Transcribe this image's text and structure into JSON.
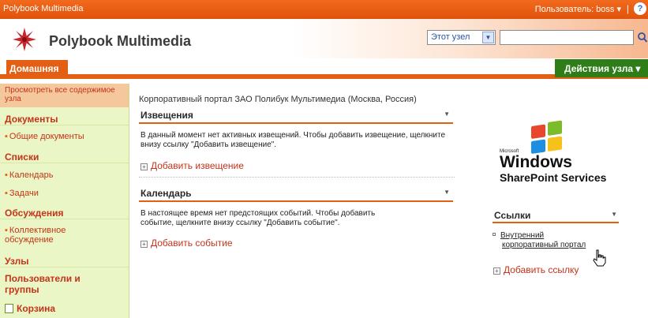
{
  "topbar": {
    "site_name": "Polybook Multimedia",
    "user_label": "Пользователь: boss ▾",
    "separator": "|",
    "help_icon": "?"
  },
  "header": {
    "title": "Polybook Multimedia",
    "scope_value": "Этот узел",
    "search_value": ""
  },
  "tabs": {
    "home_label": "Домашняя",
    "site_actions_label": "Действия узла ▾"
  },
  "leftnav": {
    "view_all": "Просмотреть все содержимое узла",
    "documents_header": "Документы",
    "documents_item": "Общие документы",
    "lists_header": "Списки",
    "lists_item_1": "Календарь",
    "lists_item_2": "Задачи",
    "discussions_header": "Обсуждения",
    "discussions_item": "Коллективное обсуждение",
    "sites_header": "Узлы",
    "people_header": "Пользователи и группы",
    "recycle_bin": "Корзина"
  },
  "main": {
    "description": "Корпоративный портал ЗАО Полибук Мультимедиа (Москва, Россия)",
    "announcements_title": "Извещения",
    "announcements_text": "В данный момент нет активных извещений. Чтобы добавить извещение, щелкните внизу ссылку \"Добавить извещение\".",
    "announcements_add": "Добавить извещение",
    "calendar_title": "Календарь",
    "calendar_text": "В настоящее время нет предстоящих событий. Чтобы добавить событие, щелкните внизу ссылку \"Добавить событие\".",
    "calendar_add": "Добавить событие"
  },
  "right": {
    "logo_microsoft": "Microsoft",
    "logo_windows": "Windows",
    "logo_sps": "SharePoint Services",
    "links_title": "Ссылки",
    "link_item_line1": "Внутренний",
    "link_item_line2": "корпоративный портал",
    "add_link": "Добавить ссылку"
  },
  "colors": {
    "accent_orange": "#e35f14",
    "nav_background": "#eaf6c5",
    "link_red": "#c4341a",
    "actions_green": "#2e7d18"
  }
}
